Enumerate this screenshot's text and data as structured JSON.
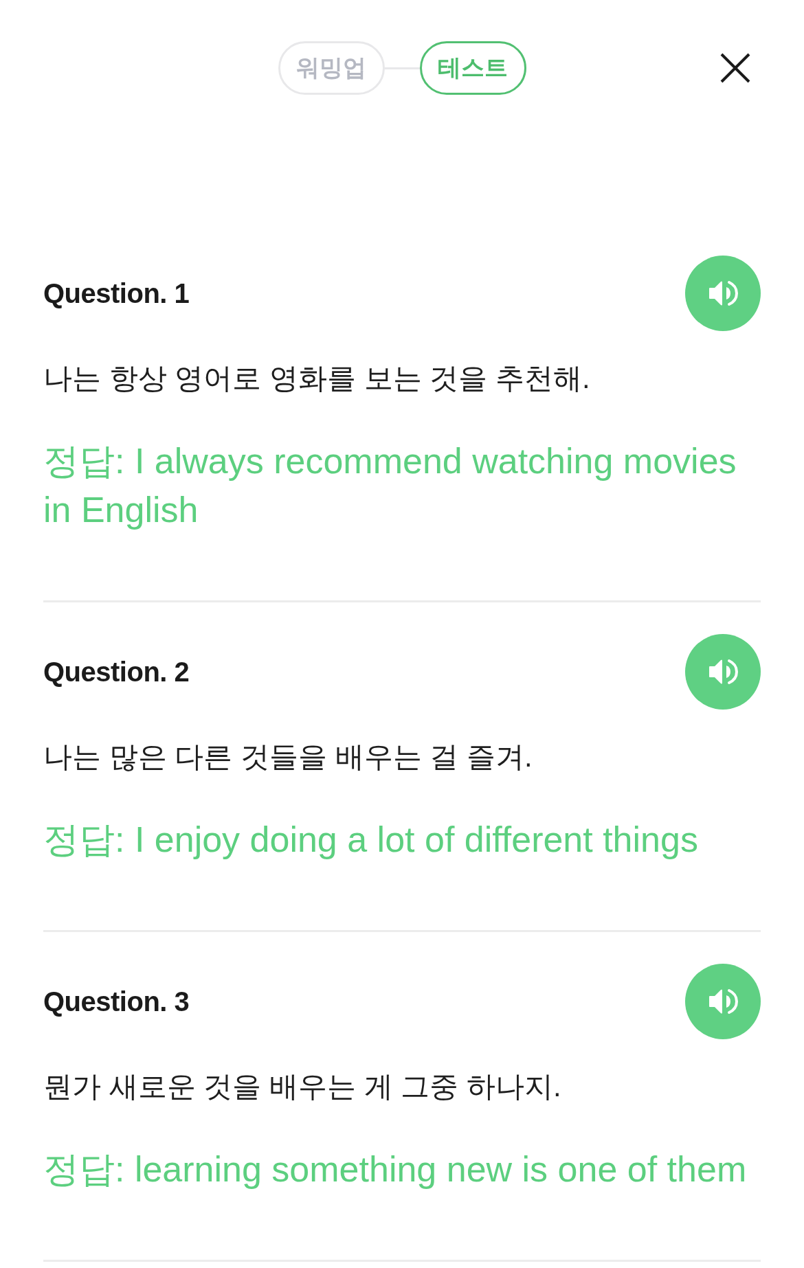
{
  "header": {
    "steps": [
      {
        "label": "워밍업",
        "selected": false
      },
      {
        "label": "테스트",
        "selected": true
      }
    ]
  },
  "questions": [
    {
      "title": "Question. 1",
      "sentence": "나는 항상 영어로 영화를 보는 것을 추천해.",
      "answer": "정답: I always recommend watching movies in English"
    },
    {
      "title": "Question. 2",
      "sentence": "나는 많은 다른 것들을 배우는 걸 즐겨.",
      "answer": "정답: I enjoy doing a lot of different things"
    },
    {
      "title": "Question. 3",
      "sentence": "뭔가 새로운 것을 배우는 게 그중 하나지.",
      "answer": "정답: learning something new is one of them"
    }
  ]
}
